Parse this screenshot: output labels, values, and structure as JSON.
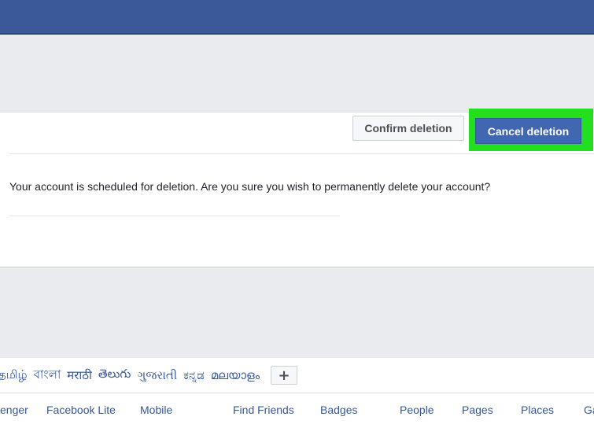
{
  "dialog": {
    "message": "Your account is scheduled for deletion. Are you sure you wish to permanently delete your account?",
    "confirm_label": "Confirm deletion",
    "cancel_label": "Cancel deletion"
  },
  "footer": {
    "languages": [
      "தமிழ்",
      "বাংলা",
      "मराठी",
      "తెలుగు",
      "ગુજરાતી",
      "ಕನ್ನಡ",
      "മലയാളം"
    ],
    "add_language": "+",
    "links": [
      "enger",
      "Facebook Lite",
      "Mobile",
      "Find Friends",
      "Badges",
      "People",
      "Pages",
      "Places",
      "Ga"
    ]
  },
  "colors": {
    "topbar": "#3b5998",
    "primary_button": "#4267b2",
    "highlight": "#22e01f",
    "link": "#365899"
  }
}
